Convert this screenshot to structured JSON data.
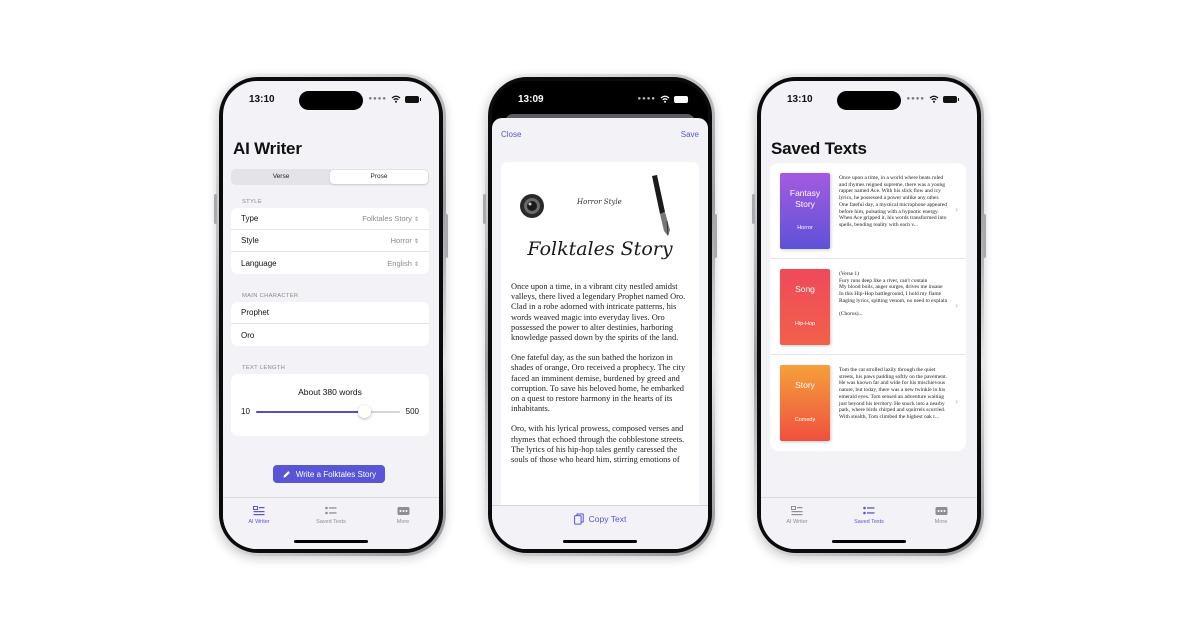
{
  "phones": {
    "writer": {
      "time": "13:10",
      "title": "AI Writer",
      "segments": [
        "Verse",
        "Prose"
      ],
      "selected_segment": "Prose",
      "style_section": "STYLE",
      "rows": [
        {
          "label": "Type",
          "value": "Folktales Story"
        },
        {
          "label": "Style",
          "value": "Horror"
        },
        {
          "label": "Language",
          "value": "English"
        }
      ],
      "main_character_section": "MAIN CHARACTER",
      "character_type": "Prophet",
      "character_name": "Oro",
      "text_length_section": "TEXT LENGTH",
      "length_label": "About 380 words",
      "slider_min": "10",
      "slider_max": "500",
      "slider_value": 380,
      "write_button": "Write a Folktales Story"
    },
    "story": {
      "time": "13:09",
      "close": "Close",
      "save": "Save",
      "style_tag": "Horror Style",
      "story_title": "Folktales Story",
      "paragraphs": [
        "Once upon a time, in a vibrant city nestled amidst valleys, there lived a legendary Prophet named Oro. Clad in a robe adorned with intricate patterns, his words weaved magic into everyday lives. Oro possessed the power to alter destinies, harboring knowledge passed down by the spirits of the land.",
        "One fateful day, as the sun bathed the horizon in shades of orange, Oro received a prophecy. The city faced an imminent demise, burdened by greed and corruption. To save his beloved home, he embarked on a quest to restore harmony in the hearts of its inhabitants.",
        "Oro, with his lyrical prowess, composed verses and rhymes that echoed through the cobblestone streets. The lyrics of his hip-hop tales gently caressed the souls of those who heard him, stirring emotions of"
      ],
      "copy_button": "Copy Text"
    },
    "saved": {
      "time": "13:10",
      "title": "Saved Texts",
      "items": [
        {
          "cover_title": "Fantasy Story",
          "cover_subtitle": "Horror",
          "gradient": [
            "#a35be0",
            "#5e52d8"
          ],
          "excerpt": "Once upon a time, in a world where beats ruled and rhymes reigned supreme, there was a young rapper named Ace. With his slick flow and icy lyrics, he possessed a power unlike any other. One fateful day, a mystical microphone appeared before him, pulsating with a hypnotic energy. When Ace gripped it, his words transformed into spells, bending reality with each v..."
        },
        {
          "cover_title": "Song",
          "cover_subtitle": "Hip-Hop",
          "gradient": [
            "#ee4a5a",
            "#f2604b"
          ],
          "excerpt": "(Verse 1)\nFury runs deep like a river, can't contain\nMy blood boils, anger surges, drives me insane\nIn this Hip-Hop battleground, I hold my flame\nRaging lyrics, spitting venom, no need to explain\n\n(Chorus)..."
        },
        {
          "cover_title": "Story",
          "cover_subtitle": "Comedy",
          "gradient": [
            "#f5a03a",
            "#f0503f"
          ],
          "excerpt": "Tom the cat strolled lazily through the quiet streets, his paws padding softly on the pavement. He was known far and wide for his mischievous nature, but today, there was a new twinkle in his emerald eyes. Tom sensed an adventure waiting just beyond his territory. He snuck into a nearby park, where birds chirped and squirrels scurried. With stealth, Tom climbed the highest oak t..."
        }
      ]
    }
  },
  "tabs": [
    "AI Writer",
    "Saved Texts",
    "More"
  ],
  "colors": {
    "accent": "#5856d6",
    "background": "#f2f2f7"
  }
}
